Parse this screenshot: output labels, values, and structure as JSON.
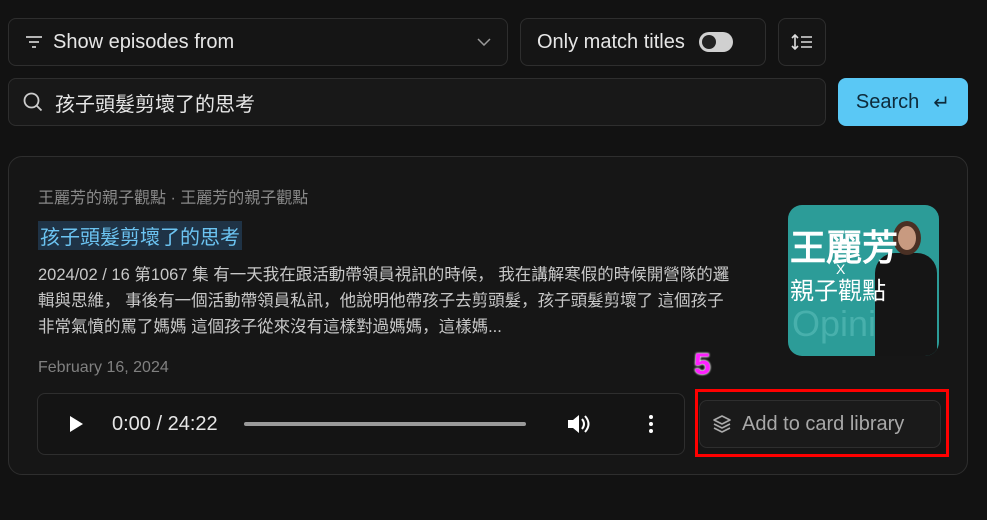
{
  "filters": {
    "show_episodes_label": "Show episodes from",
    "only_match_titles_label": "Only match titles",
    "only_match_titles_on": false
  },
  "search": {
    "value": "孩子頭髮剪壞了的思考",
    "button_label": "Search",
    "button_icon": "enter-icon"
  },
  "episode": {
    "meta": "王麗芳的親子觀點 · 王麗芳的親子觀點",
    "title": "孩子頭髮剪壞了的思考",
    "description": "2024/02 /   16  第1067     集   有一天我在跟活動帶領員視訊的時候， 我在講解寒假的時候開營隊的邏輯與思維， 事後有一個活動帶領員私訊，他說明他帶孩子去剪頭髮，孩子頭髮剪壞了 這個孩子非常氣憤的罵了媽媽 這個孩子從來沒有這樣對過媽媽，這樣媽...",
    "date": "February 16, 2024",
    "artwork": {
      "line1": "王麗芳",
      "x": "X",
      "line2": "親子觀點",
      "watermark": "Opinion"
    },
    "player": {
      "time": "0:00 / 24:22",
      "progress": 0
    },
    "add_label": "Add to card library"
  },
  "annotation": {
    "number": "5",
    "color": "#ff0000"
  },
  "colors": {
    "accent": "#5ac8f5",
    "title": "#6cc4f2"
  }
}
